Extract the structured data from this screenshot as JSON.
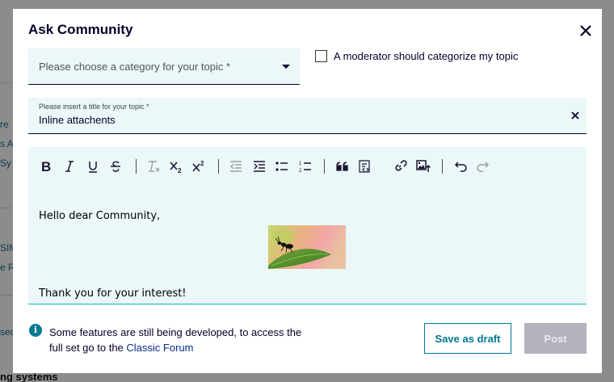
{
  "background": {
    "fragments": [
      "re",
      "s A",
      "Sy",
      "SIM",
      "e R",
      "sed"
    ],
    "bottom_text": "ng systems"
  },
  "modal": {
    "title": "Ask Community",
    "close_icon": "close-icon",
    "category": {
      "placeholder": "Please choose a category for your topic *",
      "icon": "chevron-down-icon"
    },
    "moderator_checkbox": {
      "label": "A moderator should categorize my topic",
      "checked": false
    },
    "title_field": {
      "label": "Please insert a title for your topic *",
      "value": "Inline attachents",
      "clear_icon": "close-icon"
    },
    "editor": {
      "toolbar": [
        {
          "name": "bold",
          "icon": "bold-icon",
          "enabled": true
        },
        {
          "name": "italic",
          "icon": "italic-icon",
          "enabled": true
        },
        {
          "name": "underline",
          "icon": "underline-icon",
          "enabled": true
        },
        {
          "name": "strikethrough",
          "icon": "strikethrough-icon",
          "enabled": true
        },
        {
          "name": "clear-format",
          "icon": "clear-format-icon",
          "enabled": false
        },
        {
          "name": "subscript",
          "icon": "subscript-icon",
          "enabled": true
        },
        {
          "name": "superscript",
          "icon": "superscript-icon",
          "enabled": true
        },
        {
          "name": "outdent",
          "icon": "outdent-icon",
          "enabled": false
        },
        {
          "name": "indent",
          "icon": "indent-icon",
          "enabled": true
        },
        {
          "name": "bullet-list",
          "icon": "bullet-list-icon",
          "enabled": true
        },
        {
          "name": "numbered-list",
          "icon": "numbered-list-icon",
          "enabled": true
        },
        {
          "name": "blockquote",
          "icon": "quote-icon",
          "enabled": true
        },
        {
          "name": "code-block",
          "icon": "code-block-icon",
          "enabled": true
        },
        {
          "name": "link",
          "icon": "link-icon",
          "enabled": true
        },
        {
          "name": "insert-image",
          "icon": "image-upload-icon",
          "enabled": true
        },
        {
          "name": "undo",
          "icon": "undo-icon",
          "enabled": true
        },
        {
          "name": "redo",
          "icon": "redo-icon",
          "enabled": false
        }
      ],
      "content": {
        "greeting": "Hello dear Community,",
        "closing": "Thank you for your interest!"
      }
    },
    "info": {
      "icon": "info-icon",
      "text": "Some features are still being developed, to access the full set go to the ",
      "link": "Classic Forum"
    },
    "buttons": {
      "draft": "Save as draft",
      "post": "Post"
    }
  },
  "colors": {
    "accent": "#007993",
    "field_bg": "#ebf7f8",
    "editor_focus_line": "#00c1b6",
    "disabled_button": "#b3b3be",
    "text": "#000028"
  }
}
